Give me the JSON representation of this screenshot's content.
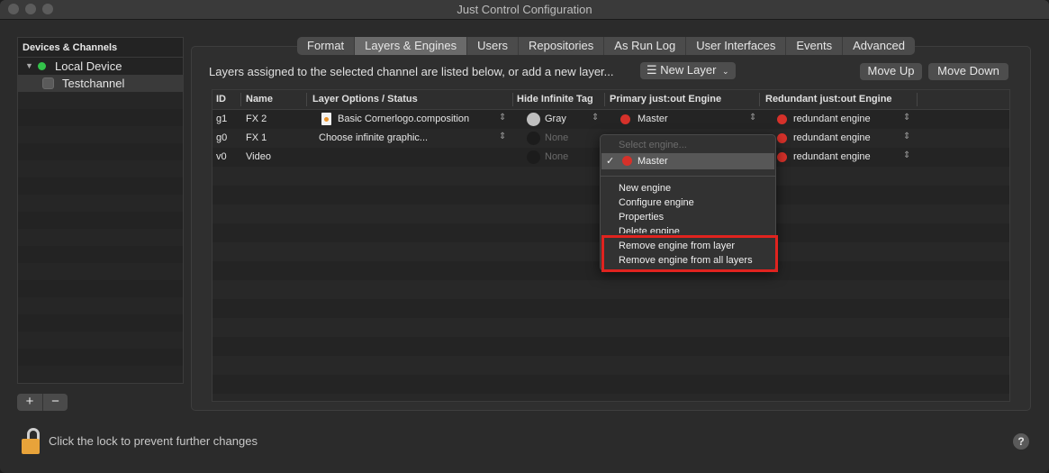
{
  "window": {
    "title": "Just Control Configuration"
  },
  "sidebar": {
    "header": "Devices & Channels",
    "device": "Local Device",
    "channel": "Testchannel",
    "add_label": "+",
    "remove_label": "−"
  },
  "tabs": [
    "Format",
    "Layers & Engines",
    "Users",
    "Repositories",
    "As Run Log",
    "User Interfaces",
    "Events",
    "Advanced"
  ],
  "active_tab": "Layers & Engines",
  "toolbar": {
    "info": "Layers assigned to the selected channel are listed below, or add a new layer...",
    "new_layer": "New Layer",
    "move_up": "Move Up",
    "move_down": "Move Down"
  },
  "table": {
    "columns": [
      "ID",
      "Name",
      "Layer Options / Status",
      "Hide Infinite Tag",
      "Primary just:out Engine",
      "Redundant just:out Engine"
    ],
    "rows": [
      {
        "id": "g1",
        "name": "FX 2",
        "options": "Basic Cornerlogo.composition",
        "hide_tag": "Gray",
        "primary": "Master",
        "redundant": "redundant engine"
      },
      {
        "id": "g0",
        "name": "FX 1",
        "options": "Choose infinite graphic...",
        "hide_tag": "None",
        "primary": "",
        "redundant": "redundant engine"
      },
      {
        "id": "v0",
        "name": "Video",
        "options": "",
        "hide_tag": "None",
        "primary": "",
        "redundant": "redundant engine"
      }
    ]
  },
  "engine_menu": {
    "placeholder": "Select engine...",
    "selected": "Master",
    "items": [
      "New engine",
      "Configure engine",
      "Properties",
      "Delete engine",
      "Remove engine from layer",
      "Remove engine from all layers"
    ]
  },
  "footer": {
    "lock_text": "Click the lock to prevent further changes",
    "help": "?"
  },
  "colors": {
    "engine_status": "#d6312a",
    "device_online": "#33c24a",
    "highlight": "#e0231f"
  }
}
